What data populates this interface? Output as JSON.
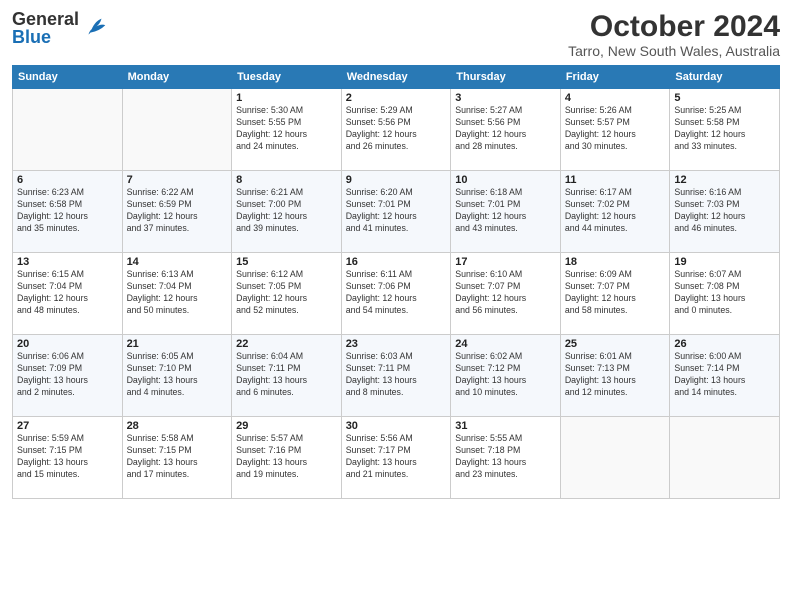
{
  "header": {
    "logo_general": "General",
    "logo_blue": "Blue",
    "title": "October 2024",
    "subtitle": "Tarro, New South Wales, Australia"
  },
  "weekdays": [
    "Sunday",
    "Monday",
    "Tuesday",
    "Wednesday",
    "Thursday",
    "Friday",
    "Saturday"
  ],
  "weeks": [
    [
      {
        "day": "",
        "info": ""
      },
      {
        "day": "",
        "info": ""
      },
      {
        "day": "1",
        "info": "Sunrise: 5:30 AM\nSunset: 5:55 PM\nDaylight: 12 hours\nand 24 minutes."
      },
      {
        "day": "2",
        "info": "Sunrise: 5:29 AM\nSunset: 5:56 PM\nDaylight: 12 hours\nand 26 minutes."
      },
      {
        "day": "3",
        "info": "Sunrise: 5:27 AM\nSunset: 5:56 PM\nDaylight: 12 hours\nand 28 minutes."
      },
      {
        "day": "4",
        "info": "Sunrise: 5:26 AM\nSunset: 5:57 PM\nDaylight: 12 hours\nand 30 minutes."
      },
      {
        "day": "5",
        "info": "Sunrise: 5:25 AM\nSunset: 5:58 PM\nDaylight: 12 hours\nand 33 minutes."
      }
    ],
    [
      {
        "day": "6",
        "info": "Sunrise: 6:23 AM\nSunset: 6:58 PM\nDaylight: 12 hours\nand 35 minutes."
      },
      {
        "day": "7",
        "info": "Sunrise: 6:22 AM\nSunset: 6:59 PM\nDaylight: 12 hours\nand 37 minutes."
      },
      {
        "day": "8",
        "info": "Sunrise: 6:21 AM\nSunset: 7:00 PM\nDaylight: 12 hours\nand 39 minutes."
      },
      {
        "day": "9",
        "info": "Sunrise: 6:20 AM\nSunset: 7:01 PM\nDaylight: 12 hours\nand 41 minutes."
      },
      {
        "day": "10",
        "info": "Sunrise: 6:18 AM\nSunset: 7:01 PM\nDaylight: 12 hours\nand 43 minutes."
      },
      {
        "day": "11",
        "info": "Sunrise: 6:17 AM\nSunset: 7:02 PM\nDaylight: 12 hours\nand 44 minutes."
      },
      {
        "day": "12",
        "info": "Sunrise: 6:16 AM\nSunset: 7:03 PM\nDaylight: 12 hours\nand 46 minutes."
      }
    ],
    [
      {
        "day": "13",
        "info": "Sunrise: 6:15 AM\nSunset: 7:04 PM\nDaylight: 12 hours\nand 48 minutes."
      },
      {
        "day": "14",
        "info": "Sunrise: 6:13 AM\nSunset: 7:04 PM\nDaylight: 12 hours\nand 50 minutes."
      },
      {
        "day": "15",
        "info": "Sunrise: 6:12 AM\nSunset: 7:05 PM\nDaylight: 12 hours\nand 52 minutes."
      },
      {
        "day": "16",
        "info": "Sunrise: 6:11 AM\nSunset: 7:06 PM\nDaylight: 12 hours\nand 54 minutes."
      },
      {
        "day": "17",
        "info": "Sunrise: 6:10 AM\nSunset: 7:07 PM\nDaylight: 12 hours\nand 56 minutes."
      },
      {
        "day": "18",
        "info": "Sunrise: 6:09 AM\nSunset: 7:07 PM\nDaylight: 12 hours\nand 58 minutes."
      },
      {
        "day": "19",
        "info": "Sunrise: 6:07 AM\nSunset: 7:08 PM\nDaylight: 13 hours\nand 0 minutes."
      }
    ],
    [
      {
        "day": "20",
        "info": "Sunrise: 6:06 AM\nSunset: 7:09 PM\nDaylight: 13 hours\nand 2 minutes."
      },
      {
        "day": "21",
        "info": "Sunrise: 6:05 AM\nSunset: 7:10 PM\nDaylight: 13 hours\nand 4 minutes."
      },
      {
        "day": "22",
        "info": "Sunrise: 6:04 AM\nSunset: 7:11 PM\nDaylight: 13 hours\nand 6 minutes."
      },
      {
        "day": "23",
        "info": "Sunrise: 6:03 AM\nSunset: 7:11 PM\nDaylight: 13 hours\nand 8 minutes."
      },
      {
        "day": "24",
        "info": "Sunrise: 6:02 AM\nSunset: 7:12 PM\nDaylight: 13 hours\nand 10 minutes."
      },
      {
        "day": "25",
        "info": "Sunrise: 6:01 AM\nSunset: 7:13 PM\nDaylight: 13 hours\nand 12 minutes."
      },
      {
        "day": "26",
        "info": "Sunrise: 6:00 AM\nSunset: 7:14 PM\nDaylight: 13 hours\nand 14 minutes."
      }
    ],
    [
      {
        "day": "27",
        "info": "Sunrise: 5:59 AM\nSunset: 7:15 PM\nDaylight: 13 hours\nand 15 minutes."
      },
      {
        "day": "28",
        "info": "Sunrise: 5:58 AM\nSunset: 7:15 PM\nDaylight: 13 hours\nand 17 minutes."
      },
      {
        "day": "29",
        "info": "Sunrise: 5:57 AM\nSunset: 7:16 PM\nDaylight: 13 hours\nand 19 minutes."
      },
      {
        "day": "30",
        "info": "Sunrise: 5:56 AM\nSunset: 7:17 PM\nDaylight: 13 hours\nand 21 minutes."
      },
      {
        "day": "31",
        "info": "Sunrise: 5:55 AM\nSunset: 7:18 PM\nDaylight: 13 hours\nand 23 minutes."
      },
      {
        "day": "",
        "info": ""
      },
      {
        "day": "",
        "info": ""
      }
    ]
  ]
}
